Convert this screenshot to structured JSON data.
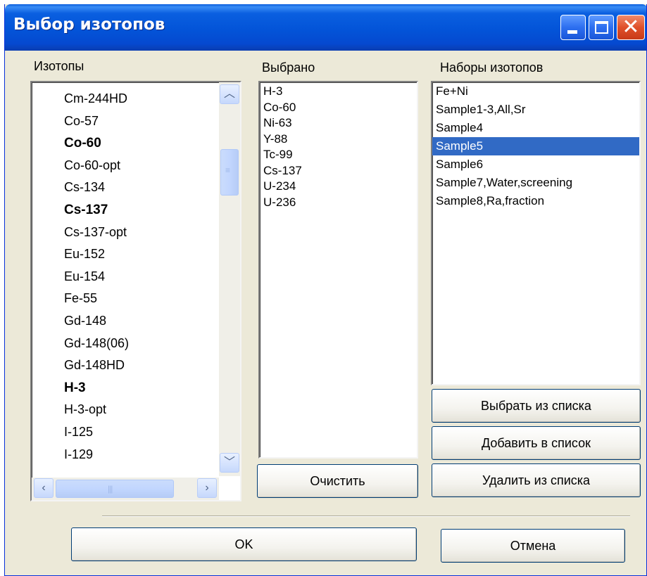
{
  "window": {
    "title": "Выбор изотопов"
  },
  "isotopes": {
    "label": "Изотопы",
    "items": [
      {
        "name": "Cm-244HD",
        "bold": false
      },
      {
        "name": "Co-57",
        "bold": false
      },
      {
        "name": "Co-60",
        "bold": true
      },
      {
        "name": "Co-60-opt",
        "bold": false
      },
      {
        "name": "Cs-134",
        "bold": false
      },
      {
        "name": "Cs-137",
        "bold": true
      },
      {
        "name": "Cs-137-opt",
        "bold": false
      },
      {
        "name": "Eu-152",
        "bold": false
      },
      {
        "name": "Eu-154",
        "bold": false
      },
      {
        "name": "Fe-55",
        "bold": false
      },
      {
        "name": "Gd-148",
        "bold": false
      },
      {
        "name": "Gd-148(06)",
        "bold": false
      },
      {
        "name": "Gd-148HD",
        "bold": false
      },
      {
        "name": "H-3",
        "bold": true
      },
      {
        "name": "H-3-opt",
        "bold": false
      },
      {
        "name": "I-125",
        "bold": false
      },
      {
        "name": "I-129",
        "bold": false
      }
    ]
  },
  "selected": {
    "label": "Выбрано",
    "items": [
      "H-3",
      "Co-60",
      "Ni-63",
      "Y-88",
      "Tc-99",
      "Cs-137",
      "U-234",
      "U-236"
    ],
    "clear_label": "Очистить"
  },
  "sets": {
    "label": "Наборы изотопов",
    "items": [
      "Fe+Ni",
      "Sample1-3,All,Sr",
      "Sample4",
      "Sample5",
      "Sample6",
      "Sample7,Water,screening",
      "Sample8,Ra,fraction"
    ],
    "selected_item": "Sample5",
    "choose_label": "Выбрать из списка",
    "add_label": "Добавить в список",
    "remove_label": "Удалить из списка"
  },
  "footer": {
    "ok_label": "OK",
    "cancel_label": "Отмена"
  },
  "colors": {
    "title_bar": "#0a5fe0",
    "selection": "#316ac5",
    "dialog_bg": "#ece9d8"
  }
}
